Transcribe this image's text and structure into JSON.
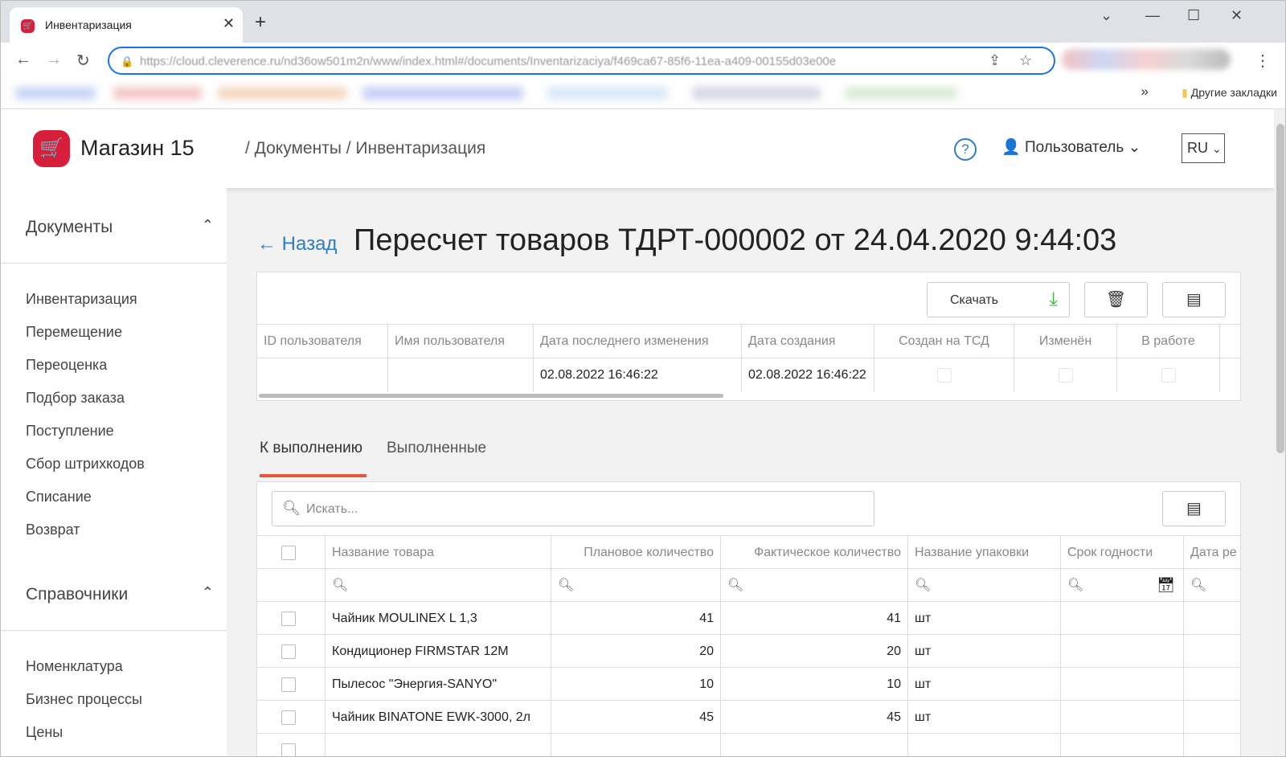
{
  "browser": {
    "tab_title": "Инвентаризация",
    "url": "https://cloud.cleverence.ru/nd36ow501m2n/www/index.html#/documents/Inventarizaciya/f469ca67-85f6-11ea-a409-00155d03e00e",
    "other_bookmarks": "Другие закладки",
    "more_bookmarks": "»"
  },
  "header": {
    "shop_name": "Магазин 15",
    "breadcrumb": "/ Документы / Инвентаризация",
    "help": "?",
    "user_label": "Пользователь",
    "lang": "RU"
  },
  "sidebar": {
    "groups": [
      {
        "title": "Документы",
        "items": [
          "Инвентаризация",
          "Перемещение",
          "Переоценка",
          "Подбор заказа",
          "Поступление",
          "Сбор штрихкодов",
          "Списание",
          "Возврат"
        ]
      },
      {
        "title": "Справочники",
        "items": [
          "Номенклатура",
          "Бизнес процессы",
          "Цены"
        ]
      }
    ]
  },
  "page": {
    "back_label": "← Назад",
    "title": "Пересчет товаров ТДРТ-000002 от 24.04.2020 9:44:03"
  },
  "doc_actions": {
    "download_label": "Скачать"
  },
  "doc_table": {
    "headers": [
      "ID пользователя",
      "Имя пользователя",
      "Дата последнего изменения",
      "Дата создания",
      "Создан на ТСД",
      "Изменён",
      "В работе"
    ],
    "row": [
      "",
      "",
      "02.08.2022 16:46:22",
      "02.08.2022 16:46:22"
    ]
  },
  "tabs": [
    "К выполнению",
    "Выполненные"
  ],
  "search": {
    "placeholder": "Искать..."
  },
  "grid": {
    "headers": [
      "Название товара",
      "Плановое количество",
      "Фактическое количество",
      "Название упаковки",
      "Срок годности",
      "Дата ре"
    ],
    "rows": [
      {
        "name": "Чайник MOULINEX L 1,3",
        "plan": "41",
        "fact": "41",
        "unit": "шт"
      },
      {
        "name": "Кондиционер FIRMSTAR 12M",
        "plan": "20",
        "fact": "20",
        "unit": "шт"
      },
      {
        "name": "Пылесос \"Энергия-SANYO\"",
        "plan": "10",
        "fact": "10",
        "unit": "шт"
      },
      {
        "name": "Чайник BINATONE EWK-3000, 2л",
        "plan": "45",
        "fact": "45",
        "unit": "шт"
      }
    ]
  },
  "colors": {
    "brand": "#d71f3c",
    "accent": "#2f7dc6",
    "tab_underline": "#e8553e",
    "download_icon": "#3cb043"
  }
}
